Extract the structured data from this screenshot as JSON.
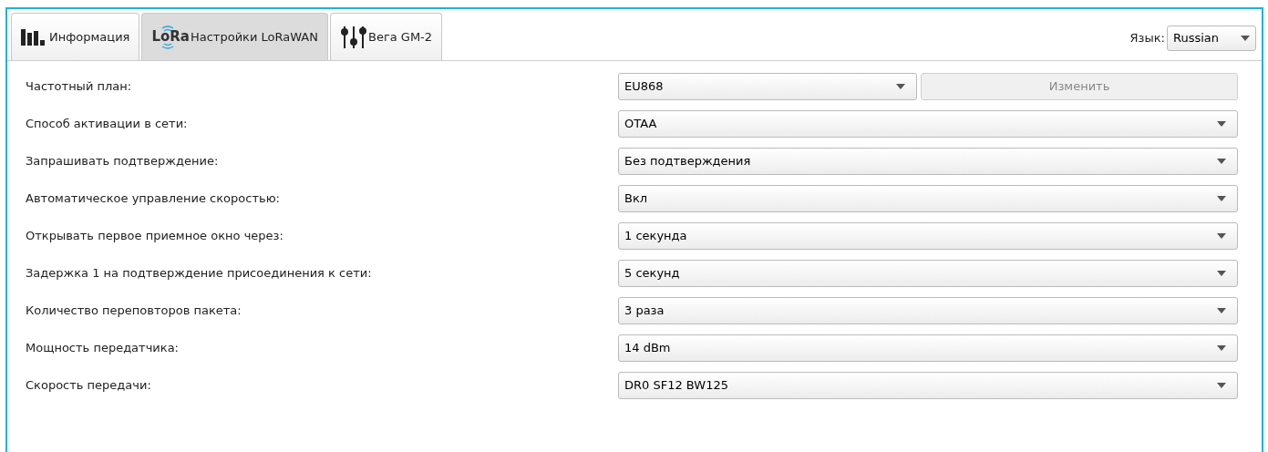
{
  "tabs": [
    {
      "label": "Информация",
      "kind": "bars",
      "selected": false
    },
    {
      "label": "Настройки LoRaWAN",
      "kind": "lora",
      "icon_text": "LoRa",
      "selected": true
    },
    {
      "label": "Вега GM-2",
      "kind": "sliders",
      "selected": false
    }
  ],
  "language": {
    "label": "Язык:",
    "value": "Russian"
  },
  "settings": [
    {
      "label": "Частотный план:",
      "value": "EU868",
      "button": {
        "label": "Изменить",
        "disabled": true
      }
    },
    {
      "label": "Способ активации в сети:",
      "value": "OTAA"
    },
    {
      "label": "Запрашивать подтверждение:",
      "value": "Без подтверждения"
    },
    {
      "label": "Автоматическое управление скоростью:",
      "value": "Вкл"
    },
    {
      "label": "Открывать первое приемное окно через:",
      "value": "1 секунда"
    },
    {
      "label": "Задержка 1 на подтверждение присоединения к сети:",
      "value": "5 секунд"
    },
    {
      "label": "Количество переповторов пакета:",
      "value": "3 раза"
    },
    {
      "label": "Мощность передатчика:",
      "value": "14 dBm"
    },
    {
      "label": "Скорость передачи:",
      "value": "DR0 SF12 BW125"
    }
  ]
}
